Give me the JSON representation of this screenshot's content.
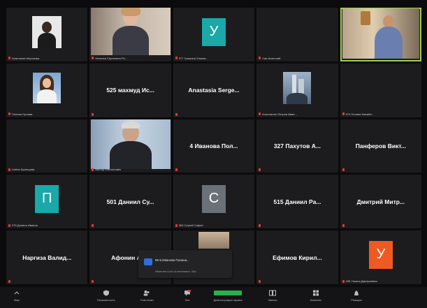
{
  "colors": {
    "active_speaker": "#9fd34a",
    "teal_avatar": "#1aa8a8",
    "gray_avatar": "#6b7177",
    "orange_avatar": "#ee5a22",
    "muted": "#e23b3b"
  },
  "tiles": [
    {
      "kind": "photo",
      "name": "Анастасия Морозова"
    },
    {
      "kind": "photo",
      "name": "Наталья Сергеевна Ро..."
    },
    {
      "kind": "letter",
      "letter": "У",
      "color": "#1aa8a8",
      "name": "377 Гришина Ульяна..."
    },
    {
      "kind": "empty",
      "name": "Сав Анатолий"
    },
    {
      "kind": "photo",
      "name": "",
      "active": true
    },
    {
      "kind": "photo",
      "name": "Полина Орлова"
    },
    {
      "kind": "text",
      "center": "525 махмуд Ис...",
      "name": ""
    },
    {
      "kind": "text",
      "center": "Anastasia Serge...",
      "name": ""
    },
    {
      "kind": "photo",
      "name": "Константин Петров Иван..."
    },
    {
      "kind": "empty",
      "name": "574 Полина Михайл..."
    },
    {
      "kind": "empty",
      "name": "Алёна Кузнецова"
    },
    {
      "kind": "photo",
      "name": "Виктор Малхасович"
    },
    {
      "kind": "text",
      "center": "4 Иванова Пол...",
      "name": ""
    },
    {
      "kind": "text",
      "center": "327 Пахутов А...",
      "name": ""
    },
    {
      "kind": "text",
      "center": "Панферов Викт...",
      "name": ""
    },
    {
      "kind": "letter",
      "letter": "П",
      "color": "#1aa8a8",
      "name": "576 Данила Иванов"
    },
    {
      "kind": "text",
      "center": "501 Даниил Су...",
      "name": ""
    },
    {
      "kind": "letter",
      "letter": "С",
      "color": "#6b7177",
      "name": "383 Сергей Сафин"
    },
    {
      "kind": "text",
      "center": "515 Даниил Ра...",
      "name": ""
    },
    {
      "kind": "text",
      "center": "Дмитрий Митр...",
      "name": ""
    },
    {
      "kind": "text",
      "center": "Наргиза Валид...",
      "name": ""
    },
    {
      "kind": "text",
      "center": "Афонин Ар...",
      "name": ""
    },
    {
      "kind": "photo",
      "name": ""
    },
    {
      "kind": "text",
      "center": "Ефимов Кирил...",
      "name": ""
    },
    {
      "kind": "letter",
      "letter": "У",
      "color": "#ee5a22",
      "name": "335 Ульяна Дмитриевна"
    }
  ],
  "tooltip": {
    "badge": "",
    "line1": "95-6 Иванова Полина...",
    "line2": "Иванова Алла Алексеевна, 93a"
  },
  "toolbar": {
    "items": [
      {
        "label": "Звук",
        "icon": "chevron-up-icon"
      },
      {
        "label": "Безопасность",
        "icon": "shield-icon"
      },
      {
        "label": "Участники",
        "icon": "participants-icon"
      },
      {
        "label": "Чат",
        "icon": "chat-icon"
      },
      {
        "label": "Демонстрация экрана",
        "icon": "share-screen-icon"
      },
      {
        "label": "Запись",
        "icon": "record-icon"
      },
      {
        "label": "Комнаты",
        "icon": "breakout-icon"
      },
      {
        "label": "Реакции",
        "icon": "reactions-icon"
      }
    ]
  }
}
